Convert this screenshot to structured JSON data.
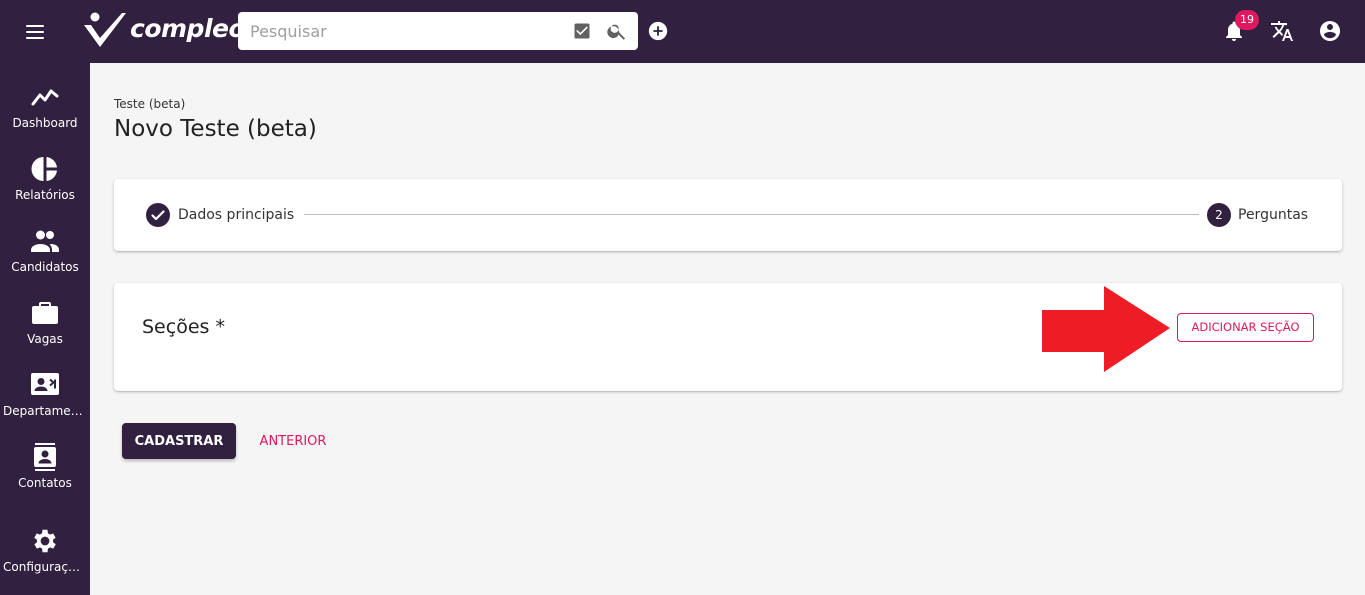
{
  "topbar": {
    "logo_text": "compleo",
    "search": {
      "placeholder": "Pesquisar",
      "value": ""
    },
    "notifications_count": "19",
    "icons": [
      "menu-icon",
      "check-box-icon",
      "search-icon",
      "add-circle-icon",
      "bell-icon",
      "translate-icon",
      "account-circle-icon"
    ]
  },
  "sidebar": {
    "items": [
      {
        "label": "Dashboard",
        "icon": "chart-line-icon"
      },
      {
        "label": "Relatórios",
        "icon": "pie-chart-icon"
      },
      {
        "label": "Candidatos",
        "icon": "people-icon"
      },
      {
        "label": "Vagas",
        "icon": "briefcase-icon"
      },
      {
        "label": "Departamentos",
        "icon": "contact-card-icon"
      },
      {
        "label": "Contatos",
        "icon": "contacts-icon"
      },
      {
        "label": "Configurações",
        "icon": "gear-icon"
      }
    ]
  },
  "page": {
    "breadcrumb": "Teste (beta)",
    "title": "Novo Teste (beta)"
  },
  "stepper": {
    "steps": [
      {
        "label": "Dados principais",
        "state": "done"
      },
      {
        "label": "Perguntas",
        "number": "2",
        "state": "active"
      }
    ]
  },
  "sections": {
    "title": "Seções *",
    "add_button": "ADICIONAR SEÇÃO"
  },
  "actions": {
    "submit": "CADASTRAR",
    "back": "ANTERIOR"
  },
  "colors": {
    "brand_dark": "#31203f",
    "accent": "#e0185e",
    "annotation_arrow": "#ee1c25"
  }
}
